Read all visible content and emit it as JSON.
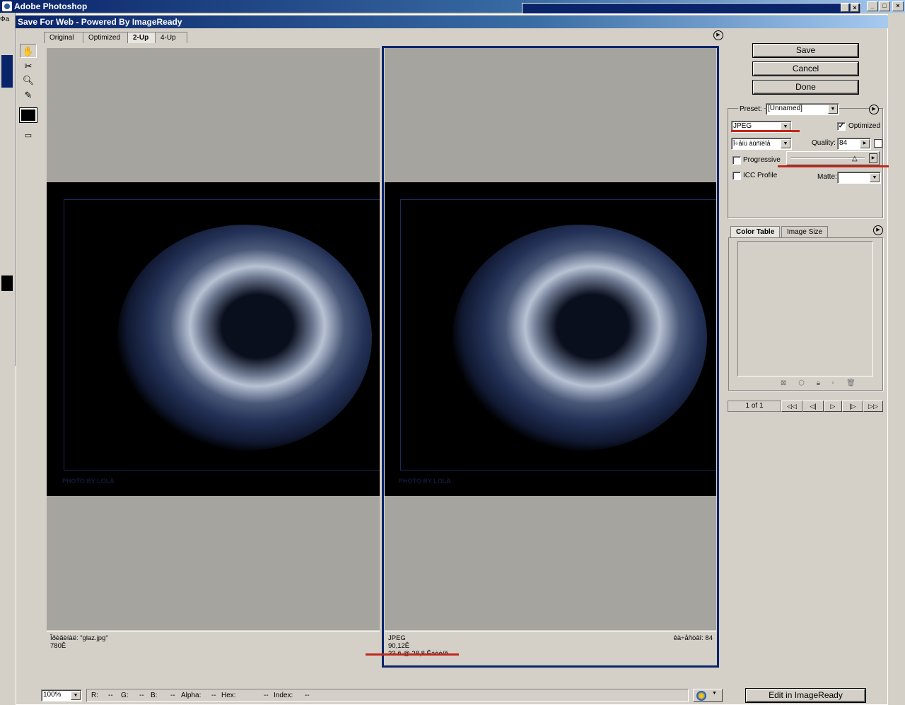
{
  "app": {
    "title": "Adobe Photoshop",
    "menu_fragment": "Фа",
    "window_controls": {
      "minimize": "_",
      "maximize": "□",
      "close": "×"
    }
  },
  "dialog": {
    "title": "Save For Web - Powered By ImageReady",
    "tabs": [
      {
        "label": "Original",
        "active": false
      },
      {
        "label": "Optimized",
        "active": false
      },
      {
        "label": "2-Up",
        "active": true
      },
      {
        "label": "4-Up",
        "active": false
      }
    ]
  },
  "tools": [
    "hand-tool-icon",
    "slice-select-icon",
    "zoom-icon",
    "eyedropper-icon",
    "eyedropper-color-swatch",
    "toggle-slices-icon"
  ],
  "left_pane": {
    "watermark": "PHOTO BY LOLA",
    "info_line1": "Îðèãèíàë: \"glaz.jpg\"",
    "info_line2": "780Ê"
  },
  "right_pane": {
    "watermark": "PHOTO BY LOLA",
    "info_line1": "JPEG",
    "info_line2": "90,12Ê",
    "info_line3": "33 ñ @ 28,8 Êáèò/ñ",
    "info_right": "êà÷åñòâî: 84"
  },
  "buttons": {
    "save": "Save",
    "cancel": "Cancel",
    "done": "Done",
    "edit_imageready": "Edit in ImageReady"
  },
  "settings": {
    "preset_label": "Preset:",
    "preset_value": "[Unnamed]",
    "format_value": "JPEG",
    "optimized_label": "Optimized",
    "optimized_checked": true,
    "compression_value": "Î÷åíü âûñîêîå",
    "quality_label": "Quality:",
    "quality_value": "84",
    "progressive_label": "Progressive",
    "progressive_checked": false,
    "icc_label": "ICC Profile",
    "icc_checked": false,
    "matte_label": "Matte:"
  },
  "color_table": {
    "tabs": [
      {
        "label": "Color Table",
        "active": true
      },
      {
        "label": "Image Size",
        "active": false
      }
    ],
    "icons": [
      "web-snap-icon",
      "cube-icon",
      "lock-icon",
      "new-color-icon",
      "trash-icon"
    ]
  },
  "animation": {
    "frame_counter": "1 of 1",
    "controls": [
      "◁◁",
      "◁|",
      "▷",
      "|▷",
      "▷▷"
    ]
  },
  "statusbar": {
    "zoom": "100%",
    "r_label": "R:",
    "r_val": "--",
    "g_label": "G:",
    "g_val": "--",
    "b_label": "B:",
    "b_val": "--",
    "alpha_label": "Alpha:",
    "alpha_val": "--",
    "hex_label": "Hex:",
    "hex_val": "--",
    "index_label": "Index:",
    "index_val": "--"
  },
  "colors": {
    "titlebar": "#0a246a",
    "selection": "#0a246a",
    "annotation_red": "#c0281c",
    "dialog_bg": "#d4d0c8",
    "canvas_bg": "#a6a49e"
  }
}
